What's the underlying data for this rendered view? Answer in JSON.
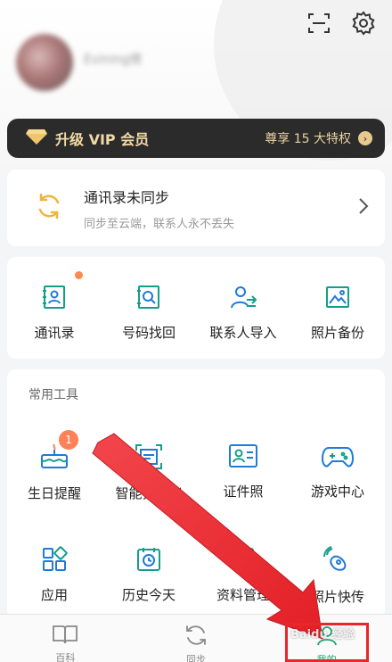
{
  "header": {
    "username": "Evining夜",
    "icons": [
      "scan-icon",
      "settings-gear-icon"
    ]
  },
  "vip": {
    "title": "升级 VIP 会员",
    "right_text": "尊享 15 大特权",
    "accent": "#f3d9a4"
  },
  "sync": {
    "title": "通讯录未同步",
    "subtitle": "同步至云端，联系人永不丢失"
  },
  "features": [
    {
      "label": "通讯录",
      "icon": "contacts-icon",
      "dot": true
    },
    {
      "label": "号码找回",
      "icon": "number-recover-icon",
      "dot": false
    },
    {
      "label": "联系人导入",
      "icon": "contact-import-icon",
      "dot": false
    },
    {
      "label": "照片备份",
      "icon": "photo-backup-icon",
      "dot": false
    }
  ],
  "tools": {
    "section_title": "常用工具",
    "row1": [
      {
        "label": "生日提醒",
        "icon": "birthday-cake-icon",
        "badge": "1"
      },
      {
        "label": "智能扫描仪",
        "icon": "smart-scanner-icon"
      },
      {
        "label": "证件照",
        "icon": "id-photo-icon"
      },
      {
        "label": "游戏中心",
        "icon": "gamepad-icon"
      }
    ],
    "row2": [
      {
        "label": "应用",
        "icon": "apps-icon"
      },
      {
        "label": "历史今天",
        "icon": "history-today-icon"
      },
      {
        "label": "资料管理",
        "icon": "data-manage-icon"
      },
      {
        "label": "照片快传",
        "icon": "photo-transfer-icon"
      }
    ]
  },
  "tabbar": [
    {
      "label": "百科",
      "icon": "book-icon",
      "active": false
    },
    {
      "label": "同步",
      "icon": "sync-icon",
      "active": false
    },
    {
      "label": "我的",
      "icon": "profile-icon",
      "active": true
    }
  ],
  "watermark": "Baidu 经验",
  "colors": {
    "primary_green": "#1aa36f",
    "annotation_red": "#e8262b",
    "badge_orange": "#ff8157"
  }
}
